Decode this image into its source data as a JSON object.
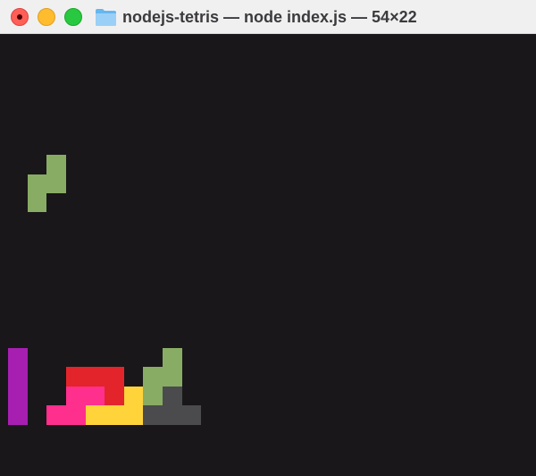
{
  "window": {
    "title": "nodejs-tetris — node index.js — 54×22",
    "folder_icon": "folder-icon",
    "controls": [
      "close-button",
      "minimize-button",
      "zoom-button"
    ]
  },
  "colors": {
    "background": "#19171a",
    "green": "#88ac64",
    "purple": "#a71fb0",
    "red": "#e3242b",
    "pink": "#ff2f8d",
    "yellow": "#ffd43b",
    "gray": "#4b4a4d"
  },
  "game": {
    "falling_piece": "green-s-piece",
    "stack_pieces": [
      "purple-i-piece",
      "red-z-piece",
      "pink-j-piece",
      "yellow-l-piece",
      "green-s-piece",
      "gray-t-piece"
    ]
  }
}
